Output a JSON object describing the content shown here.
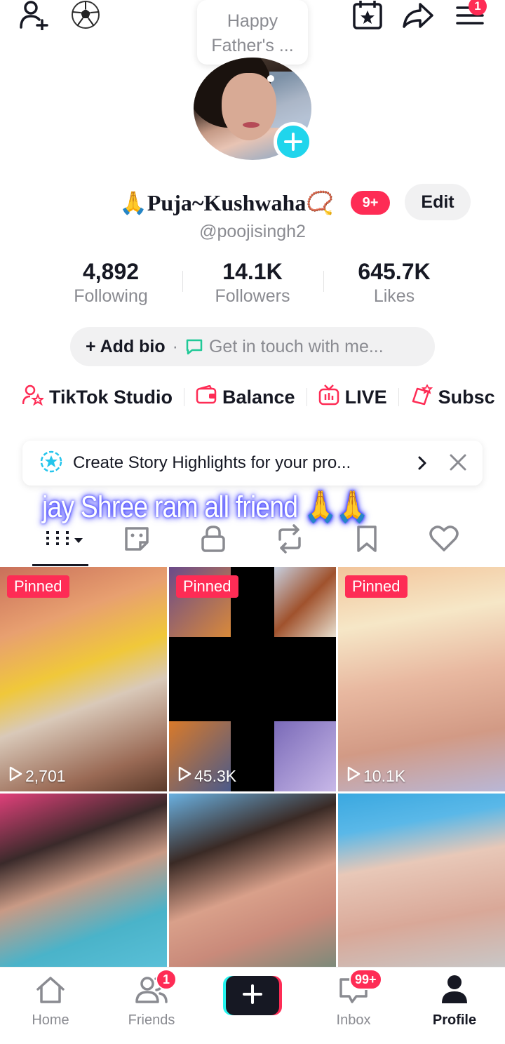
{
  "story_bubble": {
    "line1": "Happy",
    "line2": "Father's ..."
  },
  "header": {
    "menu_badge": "1"
  },
  "profile": {
    "name": "🙏Puja~Kushwaha📿",
    "name_badge": "9+",
    "edit_label": "Edit",
    "handle": "@poojisingh2"
  },
  "stats": [
    {
      "value": "4,892",
      "label": "Following"
    },
    {
      "value": "14.1K",
      "label": "Followers"
    },
    {
      "value": "645.7K",
      "label": "Likes"
    }
  ],
  "bio": {
    "add_label": "+ Add bio",
    "separator": "·",
    "contact_placeholder": "Get in touch with me..."
  },
  "tools": [
    {
      "label": "TikTok Studio",
      "icon": "person-star-icon"
    },
    {
      "label": "Balance",
      "icon": "wallet-icon"
    },
    {
      "label": "LIVE",
      "icon": "live-tv-icon"
    },
    {
      "label": "Subsc",
      "icon": "subscription-icon"
    }
  ],
  "highlight_card": {
    "text": "Create Story Highlights for your pro..."
  },
  "caption": "jay Shree ram all friend 🙏🙏",
  "tabs": [
    "videos-grid-icon",
    "sticker-icon",
    "lock-icon",
    "repost-icon",
    "bookmark-icon",
    "heart-icon"
  ],
  "videos": [
    {
      "pinned": "Pinned",
      "views": "2,701"
    },
    {
      "pinned": "Pinned",
      "views": "45.3K"
    },
    {
      "pinned": "Pinned",
      "views": "10.1K"
    },
    {
      "pinned": "",
      "views": ""
    },
    {
      "pinned": "",
      "views": ""
    },
    {
      "pinned": "",
      "views": ""
    }
  ],
  "bottom_nav": {
    "home": "Home",
    "friends": "Friends",
    "friends_badge": "1",
    "inbox": "Inbox",
    "inbox_badge": "99+",
    "profile": "Profile"
  },
  "colors": {
    "accent": "#fe2c55",
    "cyan": "#25f4ee",
    "text": "#161823",
    "muted": "#8a8b91"
  }
}
